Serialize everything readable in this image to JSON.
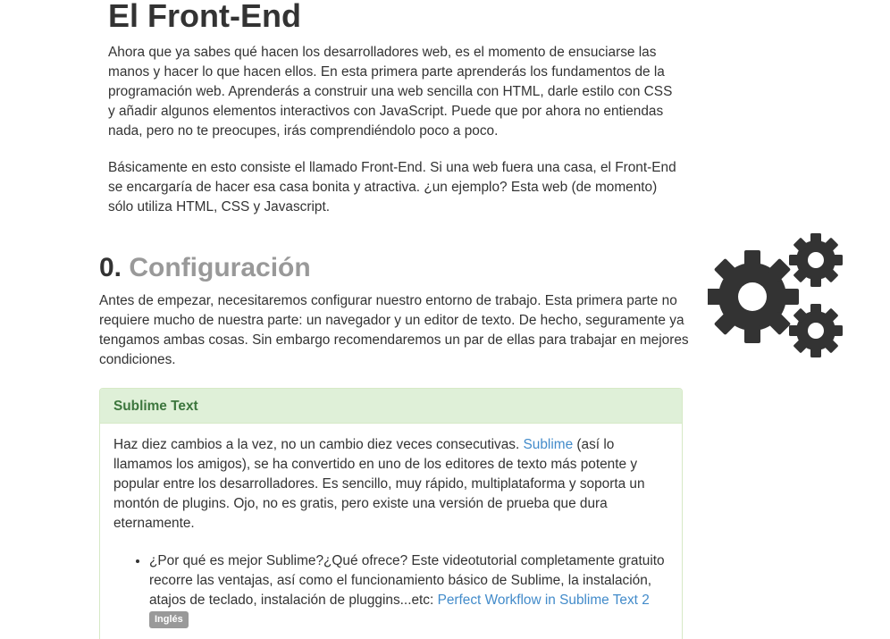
{
  "header": {
    "title": "El Front-End"
  },
  "intro": {
    "p1": "Ahora que ya sabes qué hacen los desarrolladores web, es el momento de ensuciarse las manos y hacer lo que hacen ellos. En esta primera parte aprenderás los fundamentos de la programación web. Aprenderás a construir una web sencilla con HTML, darle estilo con CSS y añadir algunos elementos interactivos con JavaScript. Puede que por ahora no entiendas nada, pero no te preocupes, irás comprendiéndolo poco a poco.",
    "p2": "Básicamente en esto consiste el llamado Front-End. Si una web fuera una casa, el Front-End se encargaría de hacer esa casa bonita y atractiva. ¿un ejemplo? Esta web (de momento) sólo utiliza HTML, CSS y Javascript."
  },
  "section": {
    "number": "0.",
    "title": "Configuración",
    "text": "Antes de empezar, necesitaremos configurar nuestro entorno de trabajo. Esta primera parte no requiere mucho de nuestra parte: un navegador y un editor de texto. De hecho, seguramente ya tengamos ambas cosas. Sin embargo recomendaremos un par de ellas para trabajar en mejores condiciones.",
    "icon": "gears-icon"
  },
  "panel": {
    "heading": "Sublime Text",
    "text_before": "Haz diez cambios a la vez, no un cambio diez veces consecutivas. ",
    "link_sublime": "Sublime",
    "text_after": " (así lo llamamos los amigos), se ha convertido en uno de los editores de texto más potente y popular entre los desarrolladores. Es sencillo, muy rápido, multiplataforma y soporta un montón de plugins. Ojo, no es gratis, pero existe una versión de prueba que dura eternamente.",
    "bullet_text": "¿Por qué es mejor Sublime?¿Qué ofrece? Este videotutorial completamente gratuito recorre las ventajas, así como el funcionamiento básico de Sublime, la instalación, atajos de teclado, instalación de pluggins...etc: ",
    "bullet_link": "Perfect Workflow in Sublime Text 2",
    "bullet_badge": "Inglés"
  },
  "colors": {
    "panel_heading_bg": "#dff0d8",
    "panel_heading_text": "#3c763d",
    "link": "#428bca",
    "muted_title": "#999999",
    "badge_bg": "#999999"
  }
}
